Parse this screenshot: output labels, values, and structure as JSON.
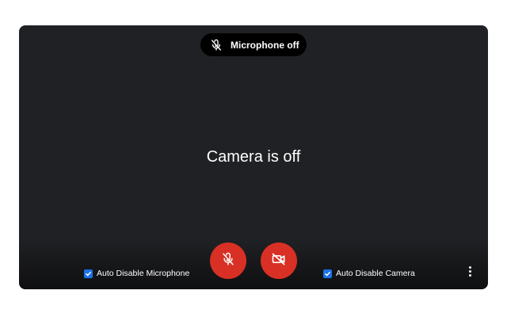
{
  "status_pill": {
    "label": "Microphone off",
    "icon": "microphone-off-icon"
  },
  "video": {
    "camera_status": "Camera is off"
  },
  "controls": {
    "mic_toggle": {
      "icon": "microphone-off-icon",
      "state": "off",
      "color": "#d93025"
    },
    "camera_toggle": {
      "icon": "camera-off-icon",
      "state": "off",
      "color": "#d93025"
    },
    "more_options": {
      "icon": "more-vertical-icon"
    }
  },
  "options": {
    "auto_disable_microphone": {
      "label": "Auto Disable Microphone",
      "checked": true
    },
    "auto_disable_camera": {
      "label": "Auto Disable Camera",
      "checked": true
    }
  },
  "colors": {
    "stage_background": "#202124",
    "accent_blue": "#1a73e8",
    "danger_red": "#d93025"
  }
}
